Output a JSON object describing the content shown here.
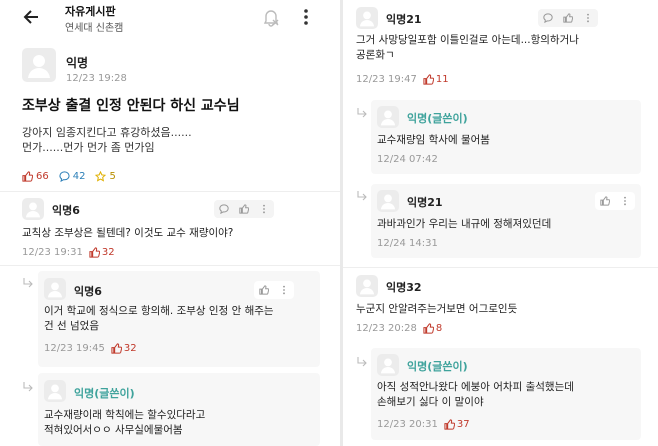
{
  "header": {
    "title": "자유게시판",
    "subtitle": "연세대 신촌캠"
  },
  "post": {
    "author": "익명",
    "time": "12/23 19:28",
    "title": "조부상 출결 인정 안된다 하신 교수님",
    "body_lines": [
      "강아지 임종지킨다고 휴강하셨음......",
      "먼가......먼가 먼가 좀 먼가임"
    ],
    "likes": "66",
    "comments": "42",
    "scraps": "5"
  },
  "comments": [
    {
      "author": "익명6",
      "body_lines": [
        "교칙상 조부상은 될텐데? 이것도 교수 재량이야?"
      ],
      "time": "12/23 19:31",
      "likes": "32"
    },
    {
      "author": "익명6",
      "body_lines": [
        "이거 학교에 정식으로 항의해. 조부상 인정 안 해주는",
        "건 선 넘었음"
      ],
      "time": "12/23 19:45",
      "likes": "32"
    },
    {
      "author": "익명(글쓴이)",
      "body_lines": [
        "교수재량이래 학칙에는 할수있다라고",
        "적혀있어서ㅇㅇ 사무실에물어봄"
      ]
    },
    {
      "author": "익명21",
      "body_lines": [
        "그거 사망당일포함 이틀인걸로 아는데...항의하거나",
        "공론화ㄱ"
      ],
      "time": "12/23 19:47",
      "likes": "11"
    },
    {
      "author": "익명(글쓴이)",
      "body_lines": [
        "교수재량임 학사에 물어봄"
      ],
      "time": "12/24 07:42"
    },
    {
      "author": "익명21",
      "body_lines": [
        "과바과인가 우리는 내규에 정해져있던데"
      ],
      "time": "12/24 14:31"
    },
    {
      "author": "익명32",
      "body_lines": [
        "누군지 안알려주는거보면 어그로인듯"
      ],
      "time": "12/23 20:28",
      "likes": "8"
    },
    {
      "author": "익명(글쓴이)",
      "body_lines": [
        "아직 성적안나왔다 에붕아 어차피 출석했는데",
        "손해보기 싫다 이 말이야"
      ],
      "time": "12/23 20:31",
      "likes": "37"
    }
  ],
  "colors": {
    "writer": "#3fa39c",
    "like": "#c0392b",
    "comment": "#2c7fb8",
    "scrap": "#e0b000",
    "reply_bg": "#f7f7f7"
  },
  "icons": [
    "back-arrow-icon",
    "bell-off-icon",
    "more-vertical-icon",
    "avatar-icon",
    "thumbs-up-icon",
    "comment-bubble-icon",
    "star-icon",
    "reply-arrow-icon"
  ]
}
